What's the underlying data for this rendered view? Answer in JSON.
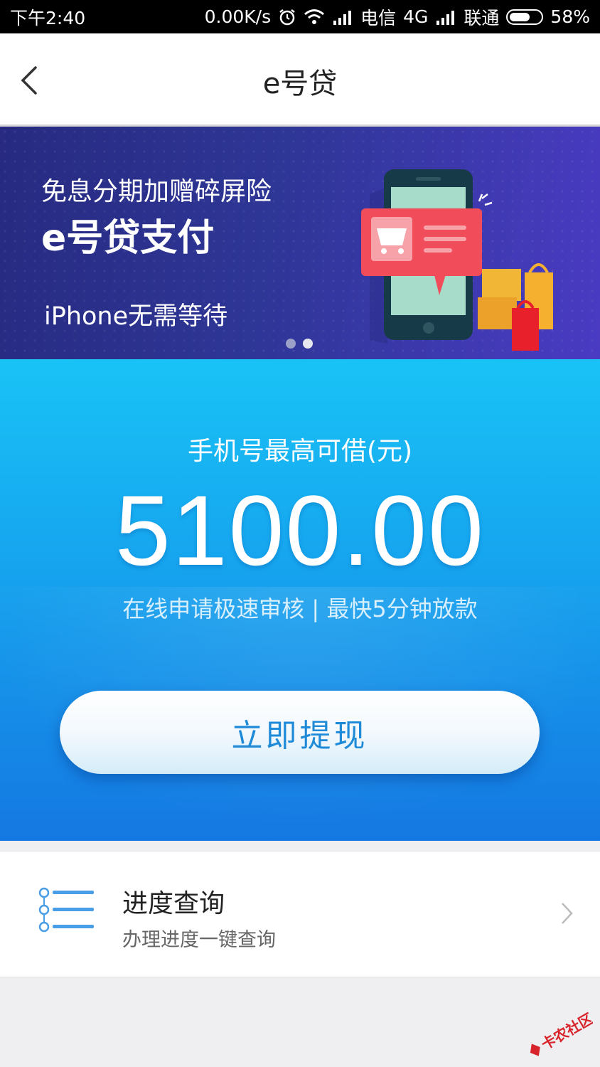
{
  "status_bar": {
    "time": "下午2:40",
    "speed": "0.00K/s",
    "carrier1": "电信",
    "network": "4G",
    "carrier2": "联通",
    "battery": "58%"
  },
  "header": {
    "title": "e号贷"
  },
  "banner": {
    "subtitle": "免息分期加赠碎屏险",
    "headline": "e号贷支付",
    "tagline": "iPhone无需等待",
    "slide_count": 2,
    "active_slide": 2
  },
  "hero": {
    "label": "手机号最高可借(元)",
    "amount": "5100.00",
    "description": "在线申请极速审核 | 最快5分钟放款",
    "button_label": "立即提现"
  },
  "progress": {
    "title": "进度查询",
    "subtitle": "办理进度一键查询"
  },
  "watermark": {
    "text": "卡农社区"
  },
  "colors": {
    "hero_top": "#19c3f6",
    "hero_bottom": "#1578e2",
    "banner": "#2e3696",
    "button_text": "#1f8bd8"
  }
}
